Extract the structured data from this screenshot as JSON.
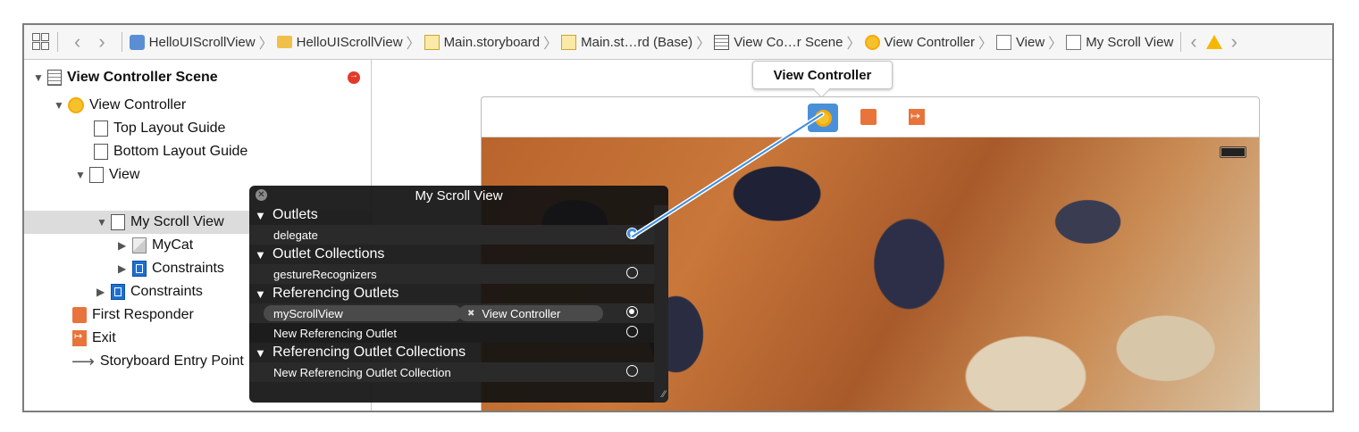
{
  "jumpbar": {
    "crumbs": [
      {
        "label": "HelloUIScrollView",
        "icon": "xcode-project-icon"
      },
      {
        "label": "HelloUIScrollView",
        "icon": "folder-icon"
      },
      {
        "label": "Main.storyboard",
        "icon": "storyboard-icon"
      },
      {
        "label": "Main.st…rd (Base)",
        "icon": "storyboard-icon"
      },
      {
        "label": "View Co…r Scene",
        "icon": "scene-icon"
      },
      {
        "label": "View Controller",
        "icon": "view-controller-icon"
      },
      {
        "label": "View",
        "icon": "view-icon"
      },
      {
        "label": "My Scroll View",
        "icon": "view-icon"
      }
    ]
  },
  "outline": {
    "scene_title": "View Controller Scene",
    "items": [
      {
        "label": "View Controller"
      },
      {
        "label": "Top Layout Guide"
      },
      {
        "label": "Bottom Layout Guide"
      },
      {
        "label": "View"
      },
      {
        "label": "My Scroll View"
      },
      {
        "label": "MyCat"
      },
      {
        "label": "Constraints"
      },
      {
        "label": "Constraints"
      },
      {
        "label": "First Responder"
      },
      {
        "label": "Exit"
      },
      {
        "label": "Storyboard Entry Point"
      }
    ]
  },
  "canvas": {
    "tooltip": "View Controller"
  },
  "hud": {
    "title": "My Scroll View",
    "sections": {
      "outlets": "Outlets",
      "outlet_collections": "Outlet Collections",
      "referencing_outlets": "Referencing Outlets",
      "referencing_outlet_collections": "Referencing Outlet Collections"
    },
    "rows": {
      "delegate": "delegate",
      "gesture": "gestureRecognizers",
      "ref_name": "myScrollView",
      "ref_target": "View Controller",
      "new_ref": "New Referencing Outlet",
      "new_ref_coll": "New Referencing Outlet Collection"
    }
  },
  "colors": {
    "accent": "#4a90d9",
    "connection_line": "#3a8ee6",
    "warning": "#f5b800",
    "error": "#e23a2a"
  }
}
